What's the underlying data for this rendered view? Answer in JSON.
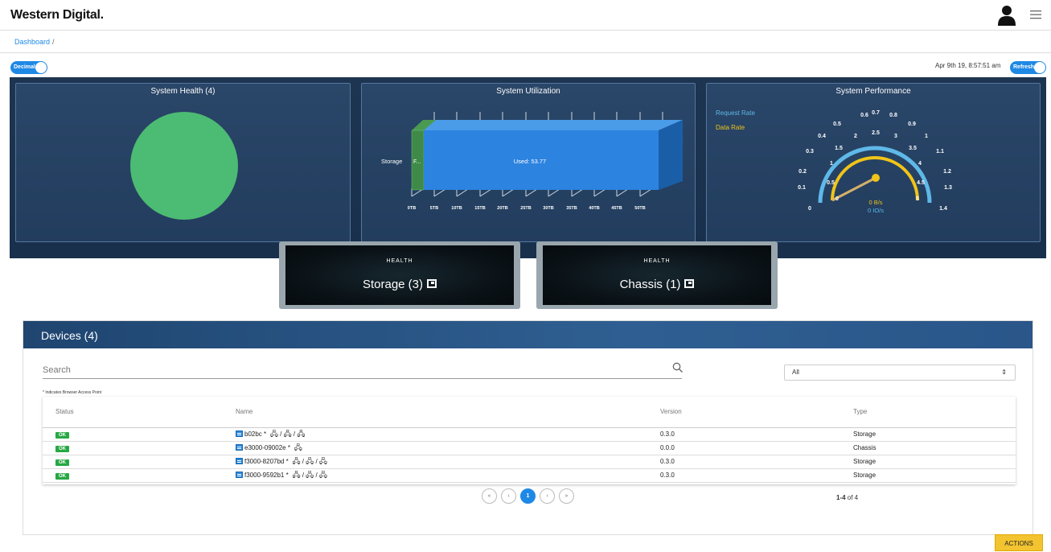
{
  "header": {
    "logo": "Western Digital.",
    "user_icon": "user-icon",
    "menu_icon": "menu-icon"
  },
  "breadcrumb": {
    "item": "Dashboard",
    "separator": "/"
  },
  "controls": {
    "decimal_toggle": "Decimal",
    "refresh_toggle": "Refresh",
    "timestamp": "Apr 9th 19, 8:57:51 am"
  },
  "panels": {
    "health": {
      "title": "System Health (4)",
      "status_color": "#4cbb73"
    },
    "utilization": {
      "title": "System Utilization",
      "category": "Storage",
      "free_label": "F...",
      "used_label": "Used: 53.77",
      "ticks": [
        "0TB",
        "5TB",
        "10TB",
        "15TB",
        "20TB",
        "25TB",
        "30TB",
        "35TB",
        "40TB",
        "45TB",
        "50TB"
      ]
    },
    "performance": {
      "title": "System Performance",
      "legend_request": "Request Rate",
      "legend_data": "Data Rate",
      "outer_ticks": [
        "0",
        "0.1",
        "0.2",
        "0.3",
        "0.4",
        "0.5",
        "0.6",
        "0.7",
        "0.8",
        "0.9",
        "1",
        "1.1",
        "1.2",
        "1.3",
        "1.4"
      ],
      "inner_ticks": [
        "0",
        "0.5",
        "1",
        "1.5",
        "2",
        "2.5",
        "3",
        "3.5",
        "4",
        "4.5",
        "5"
      ],
      "data_rate_value": "0 B/s",
      "request_rate_value": "0 IO/s"
    }
  },
  "health_cards": [
    {
      "label": "HEALTH",
      "name": "Storage (3)"
    },
    {
      "label": "HEALTH",
      "name": "Chassis (1)"
    }
  ],
  "devices": {
    "title": "Devices (4)",
    "search_placeholder": "Search",
    "filter_value": "All",
    "note": "* Indicates Browser Access Point",
    "columns": [
      "Status",
      "Name",
      "Version",
      "Type"
    ],
    "rows": [
      {
        "status": "OK",
        "name": "b02bc *",
        "links": 3,
        "version": "0.3.0",
        "type": "Storage"
      },
      {
        "status": "OK",
        "name": "e3000-09002e *",
        "links": 1,
        "version": "0.0.0",
        "type": "Chassis"
      },
      {
        "status": "OK",
        "name": "f3000-8207bd *",
        "links": 3,
        "version": "0.3.0",
        "type": "Storage"
      },
      {
        "status": "OK",
        "name": "f3000-9592b1 *",
        "links": 3,
        "version": "0.3.0",
        "type": "Storage"
      }
    ],
    "pagination": {
      "first": "«",
      "prev": "‹",
      "current": "1",
      "next": "›",
      "last": "»",
      "range_bold": "1-4",
      "range_rest": " of 4"
    }
  },
  "actions_button": "ACTIONS"
}
